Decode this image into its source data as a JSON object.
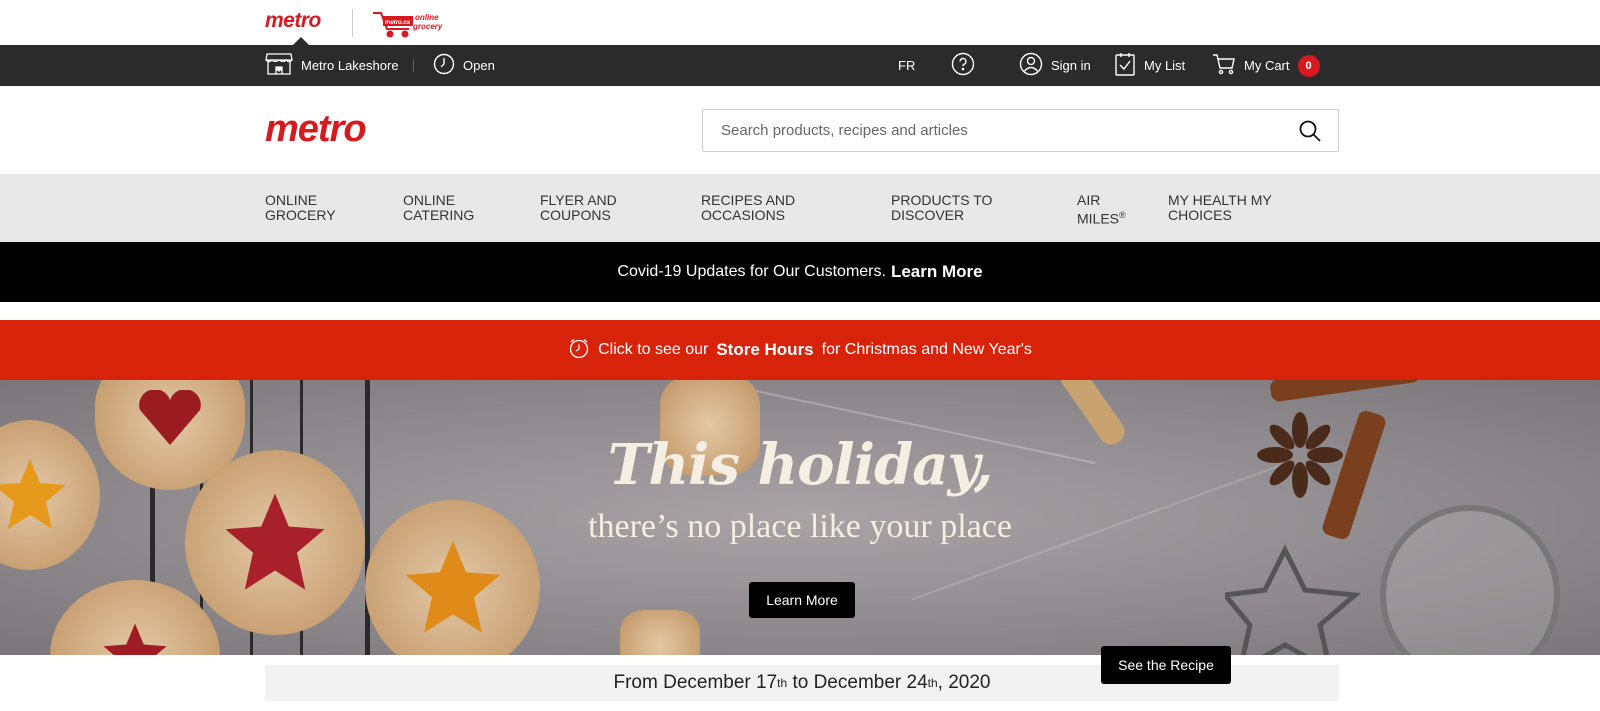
{
  "brand": {
    "logo_text": "metro",
    "online_logo_text": "online grocery",
    "online_logo_mark": "metro.ca",
    "brand_color": "#d71920"
  },
  "utility": {
    "store_name": "Metro Lakeshore",
    "store_status": "Open",
    "language": "FR",
    "sign_in": "Sign in",
    "my_list": "My List",
    "my_cart": "My Cart",
    "cart_count": "0",
    "icons": [
      "store-icon",
      "clock-icon",
      "help-icon",
      "user-icon",
      "list-icon",
      "cart-icon"
    ]
  },
  "header": {
    "logo_text": "metro",
    "search_placeholder": "Search products, recipes and articles"
  },
  "nav": {
    "items": [
      {
        "label": "ONLINE\nGROCERY"
      },
      {
        "label": "ONLINE\nCATERING"
      },
      {
        "label": "FLYER AND\nCOUPONS"
      },
      {
        "label": "RECIPES AND\nOCCASIONS"
      },
      {
        "label": "PRODUCTS TO\nDISCOVER"
      },
      {
        "label": "AIR\nMILES",
        "sup": "®"
      },
      {
        "label": "MY HEALTH MY\nCHOICES"
      }
    ]
  },
  "covid": {
    "text": "Covid-19 Updates for Our Customers.",
    "link": "Learn More"
  },
  "store_hours": {
    "prefix": "Click to see our",
    "bold": "Store Hours",
    "suffix": "for Christmas and New Year's",
    "bar_color": "#d7230a"
  },
  "hero": {
    "headline": "This holiday,",
    "subline": "there’s no place like your place",
    "button": "Learn More"
  },
  "date_band": {
    "part1": "From December 17",
    "sup1": "th",
    "part2": " to December 24",
    "sup2": "th",
    "part3": ", 2020"
  },
  "recipe_button": "See the Recipe"
}
